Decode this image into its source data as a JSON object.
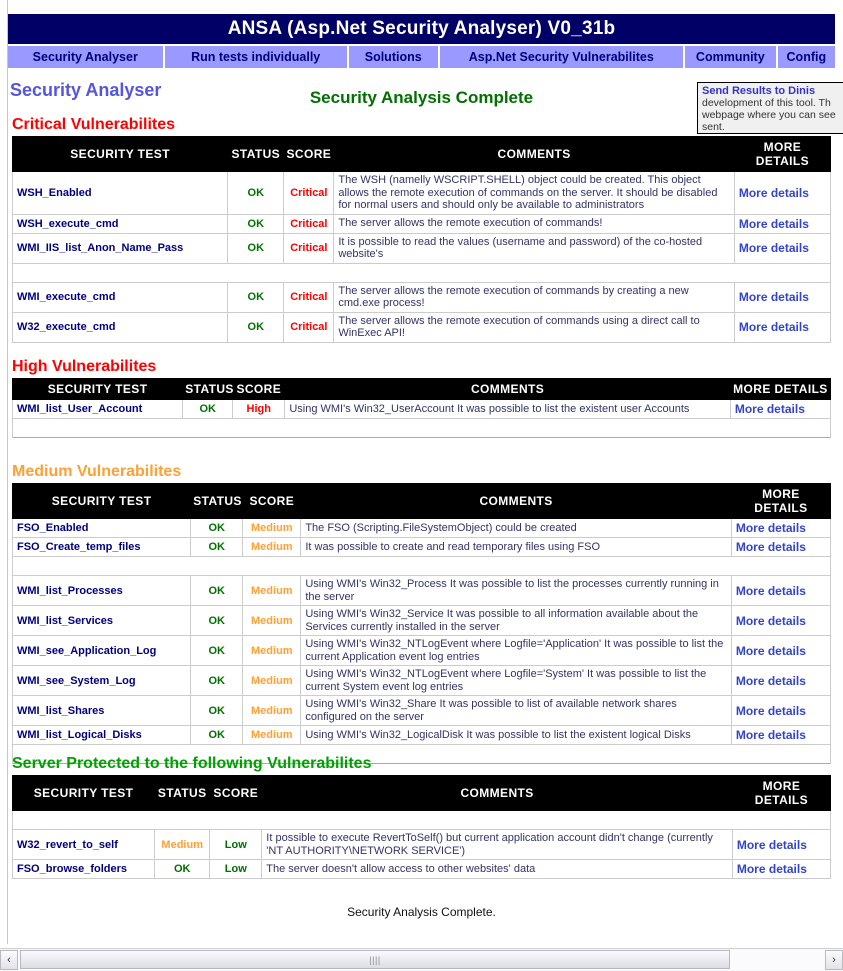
{
  "window": {
    "title": "ANSA (Asp.Net Security Analyser) V0_31b"
  },
  "nav": {
    "tabs": [
      {
        "label": "Security Analyser"
      },
      {
        "label": "Run tests individually"
      },
      {
        "label": "Solutions"
      },
      {
        "label": "Asp.Net Security Vulnerabilites"
      },
      {
        "label": "Community"
      },
      {
        "label": "Config"
      }
    ]
  },
  "headings": {
    "left": "Security Analyser",
    "center": "Security Analysis Complete"
  },
  "balloon": {
    "head": "Send Results to Dinis",
    "line2": "development of this tool. Th",
    "line3": "webpage where you can see",
    "line4": "sent."
  },
  "columns": {
    "test": "SECURITY TEST",
    "status": "STATUS",
    "score": "SCORE",
    "comments": "COMMENTS",
    "more_1": "MORE",
    "more_2": "DETAILS",
    "more_inline": "MORE DETAILS",
    "more_link": "More details"
  },
  "sections": [
    {
      "id": "critical",
      "title": "Critical Vulnerabilites",
      "rows": [
        {
          "test": "WSH_Enabled",
          "status": "OK",
          "score": "Critical",
          "comment": "The WSH (namelly WSCRIPT.SHELL) object could be created. This object allows the remote execution of commands on the server. It should be disabled for normal users and should only be available to administrators"
        },
        {
          "test": "WSH_execute_cmd",
          "status": "OK",
          "score": "Critical",
          "comment": "The server allows the remote execution of commands!"
        },
        {
          "test": "WMI_IIS_list_Anon_Name_Pass",
          "status": "OK",
          "score": "Critical",
          "comment": "It is possible to read the values (username and password) of the co-hosted website's"
        },
        {
          "spacer": true
        },
        {
          "test": "WMI_execute_cmd",
          "status": "OK",
          "score": "Critical",
          "comment": "The server allows the remote execution of commands by creating a new cmd.exe process!"
        },
        {
          "test": "W32_execute_cmd",
          "status": "OK",
          "score": "Critical",
          "comment": "The server allows the remote execution of commands using a direct call to WinExec API!"
        }
      ]
    },
    {
      "id": "high",
      "title": "High Vulnerabilites",
      "rows": [
        {
          "test": "WMI_list_User_Account",
          "status": "OK",
          "score": "High",
          "comment": "Using WMI's Win32_UserAccount It was possible to list the existent user Accounts"
        },
        {
          "spacer": true
        }
      ]
    },
    {
      "id": "medium",
      "title": "Medium Vulnerabilites",
      "rows": [
        {
          "test": "FSO_Enabled",
          "status": "OK",
          "score": "Medium",
          "comment": "The FSO (Scripting.FileSystemObject) could be created"
        },
        {
          "test": "FSO_Create_temp_files",
          "status": "OK",
          "score": "Medium",
          "comment": "It was possible to create and read temporary files using FSO"
        },
        {
          "spacer": true
        },
        {
          "test": "WMI_list_Processes",
          "status": "OK",
          "score": "Medium",
          "comment": "Using WMI's Win32_Process It was possible to list the processes currently running in the server"
        },
        {
          "test": "WMI_list_Services",
          "status": "OK",
          "score": "Medium",
          "comment": "Using WMI's Win32_Service It was possible to all information available about the Services currently installed in the server"
        },
        {
          "test": "WMI_see_Application_Log",
          "status": "OK",
          "score": "Medium",
          "comment": "Using WMI's Win32_NTLogEvent where Logfile='Application' It was possible to list the current Application event log entries"
        },
        {
          "test": "WMI_see_System_Log",
          "status": "OK",
          "score": "Medium",
          "comment": "Using WMI's Win32_NTLogEvent where Logfile='System' It was possible to list the current System event log entries"
        },
        {
          "test": "WMI_list_Shares",
          "status": "OK",
          "score": "Medium",
          "comment": "Using WMI's Win32_Share It was possible to list of available network shares configured on the server"
        },
        {
          "test": "WMI_list_Logical_Disks",
          "status": "OK",
          "score": "Medium",
          "comment": "Using WMI's Win32_LogicalDisk It was possible to list the existent logical Disks"
        },
        {
          "spacer": true
        }
      ]
    },
    {
      "id": "protected",
      "title": "Server Protected to the following Vulnerabilites",
      "rows": [
        {
          "spacer": true
        },
        {
          "test": "W32_revert_to_self",
          "status": "Medium",
          "score": "Low",
          "comment": "It possible to execute RevertToSelf() but current application account didn't change (currently 'NT AUTHORITY\\NETWORK SERVICE')"
        },
        {
          "test": "FSO_browse_folders",
          "status": "OK",
          "score": "Low",
          "comment": "The server doesn't allow access to other websites' data"
        }
      ]
    }
  ],
  "footer": {
    "text": "Security Analysis Complete."
  },
  "scrollbar": {
    "left_arrow": "‹",
    "right_arrow": "›",
    "grip": "||||"
  },
  "colors": {
    "title_bg": "#000066",
    "nav_bg": "#9999ff",
    "nav_text": "#000080",
    "critical": "#ff0000",
    "high": "#ff0000",
    "medium": "#ffa033",
    "low": "#007000",
    "ok": "#007000",
    "link": "#3344cc"
  }
}
